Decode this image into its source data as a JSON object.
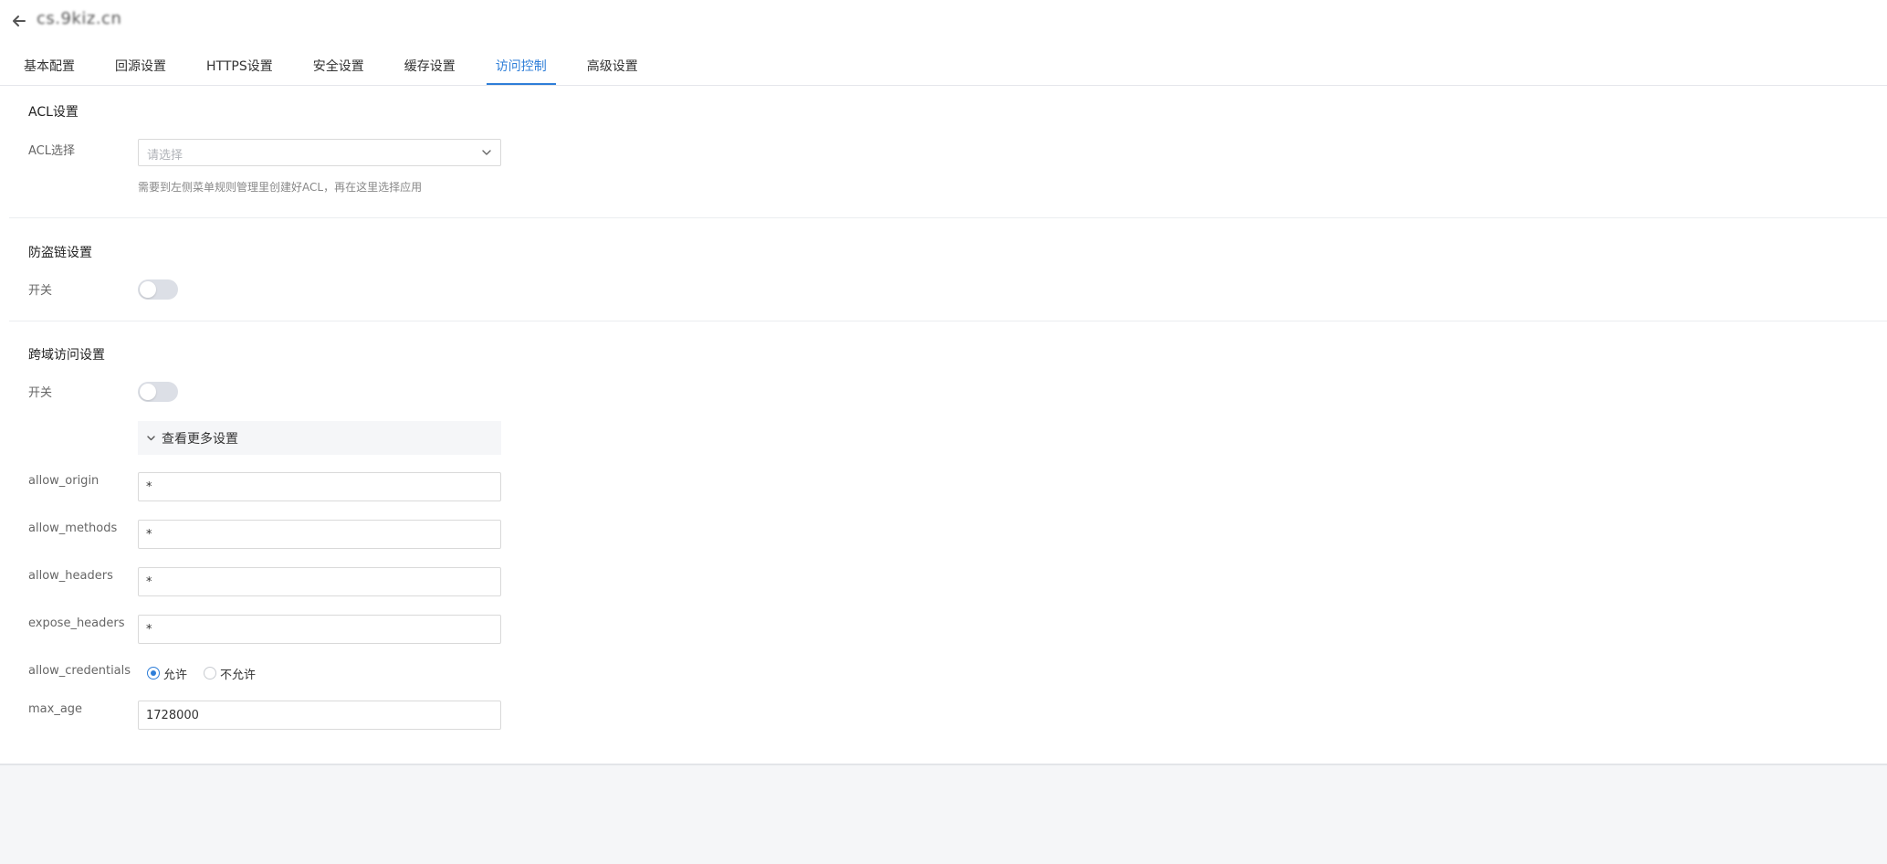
{
  "header": {
    "domain": "cs.9kiz.cn"
  },
  "tabs": [
    {
      "label": "基本配置",
      "active": false
    },
    {
      "label": "回源设置",
      "active": false
    },
    {
      "label": "HTTPS设置",
      "active": false
    },
    {
      "label": "安全设置",
      "active": false
    },
    {
      "label": "缓存设置",
      "active": false
    },
    {
      "label": "访问控制",
      "active": true
    },
    {
      "label": "高级设置",
      "active": false
    }
  ],
  "acl": {
    "title": "ACL设置",
    "select_label": "ACL选择",
    "placeholder": "请选择",
    "help": "需要到左侧菜单规则管理里创建好ACL，再在这里选择应用"
  },
  "hotlink": {
    "title": "防盗链设置",
    "switch_label": "开关",
    "enabled": false
  },
  "cors": {
    "title": "跨域访问设置",
    "switch_label": "开关",
    "enabled": false,
    "more_settings": "查看更多设置",
    "fields": {
      "allow_origin": {
        "label": "allow_origin",
        "value": "*"
      },
      "allow_methods": {
        "label": "allow_methods",
        "value": "*"
      },
      "allow_headers": {
        "label": "allow_headers",
        "value": "*"
      },
      "expose_headers": {
        "label": "expose_headers",
        "value": "*"
      }
    },
    "allow_credentials": {
      "label": "allow_credentials",
      "options": [
        "允许",
        "不允许"
      ],
      "selected": "允许"
    },
    "max_age": {
      "label": "max_age",
      "value": "1728000"
    }
  },
  "colors": {
    "accent": "#2e7ed8",
    "switch_off": "#dcdfe6",
    "footer_bg": "#f5f6f8"
  }
}
